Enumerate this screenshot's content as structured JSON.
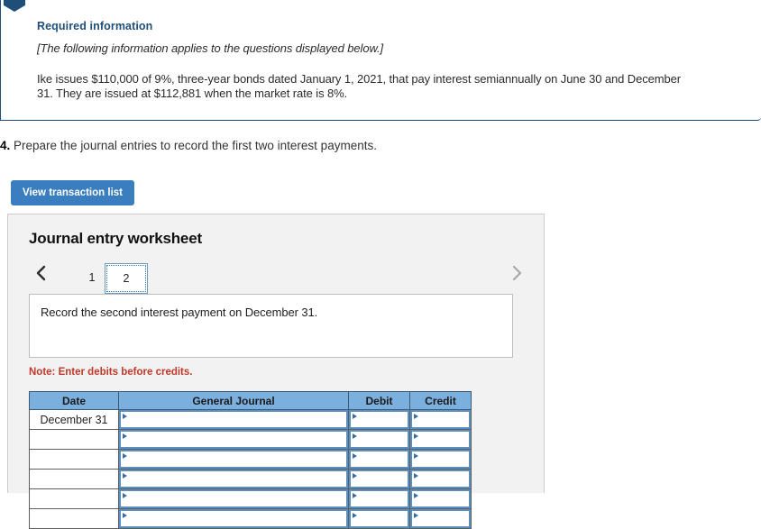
{
  "required_info": {
    "ribbon_icon": "bookmark-ribbon-icon",
    "title": "Required information",
    "subtitle": "[The following information applies to the questions displayed below.]",
    "body": "Ike issues $110,000 of 9%, three-year bonds dated January 1, 2021, that pay interest semiannually on June 30 and December 31. They are issued at $112,881 when the market rate is 8%.",
    "border_color": "#1f4e79",
    "title_color": "#1f4e79"
  },
  "question": {
    "number": "4.",
    "text": " Prepare the journal entries to record the first two interest payments."
  },
  "toolbar": {
    "view_transaction_list_label": "View transaction list",
    "button_color": "#3a7ebf"
  },
  "worksheet": {
    "title": "Journal entry worksheet",
    "pager": {
      "prev_icon": "chevron-left-icon",
      "next_icon": "chevron-right-icon",
      "tabs": [
        {
          "label": "1",
          "active": false
        },
        {
          "label": "2",
          "active": true
        }
      ]
    },
    "entry_description": "Record the second interest payment on December 31.",
    "note": "Note: Enter debits before credits.",
    "note_color": "#c0392b",
    "table": {
      "header_color": "#7bafdd",
      "columns": [
        "Date",
        "General Journal",
        "Debit",
        "Credit"
      ],
      "rows": [
        {
          "date": "December 31",
          "general_journal": "",
          "debit": "",
          "credit": ""
        },
        {
          "date": "",
          "general_journal": "",
          "debit": "",
          "credit": ""
        },
        {
          "date": "",
          "general_journal": "",
          "debit": "",
          "credit": ""
        },
        {
          "date": "",
          "general_journal": "",
          "debit": "",
          "credit": ""
        },
        {
          "date": "",
          "general_journal": "",
          "debit": "",
          "credit": ""
        },
        {
          "date": "",
          "general_journal": "",
          "debit": "",
          "credit": ""
        }
      ]
    }
  }
}
